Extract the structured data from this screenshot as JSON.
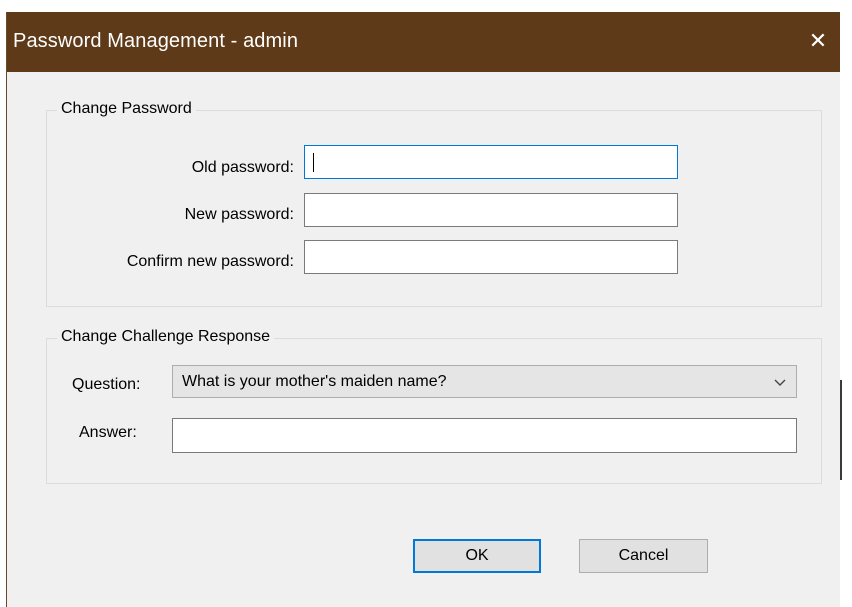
{
  "window": {
    "title": "Password Management - admin",
    "close_glyph": "✕",
    "titlebar_color": "#5e3a18",
    "accent_color": "#0078d7"
  },
  "change_password": {
    "caption": "Change Password",
    "old_password_label": "Old password:",
    "old_password_value": "",
    "new_password_label": "New password:",
    "new_password_value": "",
    "confirm_password_label": "Confirm new password:",
    "confirm_password_value": ""
  },
  "challenge": {
    "caption": "Change Challenge Response",
    "question_label": "Question:",
    "question_selected": "What is your mother's maiden name?",
    "question_icon": "chevron-down-icon",
    "answer_label": "Answer:",
    "answer_value": ""
  },
  "buttons": {
    "ok_label": "OK",
    "cancel_label": "Cancel"
  }
}
